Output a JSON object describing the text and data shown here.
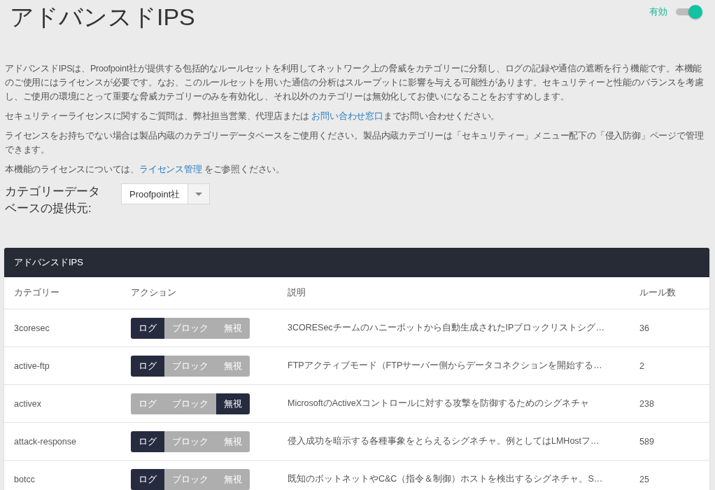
{
  "header": {
    "title": "アドバンスドIPS",
    "toggle": {
      "label": "有効",
      "on": true
    }
  },
  "paragraphs": [
    {
      "segments": [
        {
          "kind": "text",
          "text": "アドバンスドIPSは、Proofpoint社が提供する包括的なルールセットを利用してネットワーク上の脅威をカテゴリーに分類し、ログの記録や通信の遮断を行う機能です。本機能のご使用にはライセンスが必要です。なお、このルールセットを用いた通信の分析はスループットに影響を与える可能性があります。セキュリティーと性能のバランスを考慮し、ご使用の環境にとって重要な脅威カテゴリーのみを有効化し、それ以外のカテゴリーは無効化してお使いになることをおすすめします。"
        }
      ]
    },
    {
      "segments": [
        {
          "kind": "text",
          "text": "セキュリティーライセンスに関するご質問は、弊社担当営業、代理店または "
        },
        {
          "kind": "link",
          "text": "お問い合わせ窓口"
        },
        {
          "kind": "text",
          "text": "までお問い合わせください。"
        }
      ]
    },
    {
      "segments": [
        {
          "kind": "text",
          "text": "ライセンスをお持ちでない場合は製品内蔵のカテゴリーデータベースをご使用ください。製品内蔵カテゴリーは「セキュリティー」メニュー配下の「侵入防御」ページで管理できます。"
        }
      ]
    },
    {
      "segments": [
        {
          "kind": "text",
          "text": "本機能のライセンスについては、"
        },
        {
          "kind": "link",
          "text": "ライセンス管理"
        },
        {
          "kind": "text",
          "text": " をご参照ください。"
        }
      ]
    }
  ],
  "provider": {
    "label": "カテゴリーデータベースの提供元:",
    "value": "Proofpoint社"
  },
  "table": {
    "title": "アドバンスドIPS",
    "columns": [
      "カテゴリー",
      "アクション",
      "説明",
      "ルール数"
    ],
    "rows": [
      {
        "category": "3coresec",
        "actions": [
          {
            "label": "ログ",
            "selected": true
          },
          {
            "label": "ブロック",
            "selected": false
          },
          {
            "label": "無視",
            "selected": false
          }
        ],
        "description": "3CORESecチームのハニーポットから自動生成されたIPブロックリストシグ…",
        "count": "36"
      },
      {
        "category": "active-ftp",
        "actions": [
          {
            "label": "ログ",
            "selected": true
          },
          {
            "label": "ブロック",
            "selected": false
          },
          {
            "label": "無視",
            "selected": false
          }
        ],
        "description": "FTPアクティブモード（FTPサーバー側からデータコネクションを開始する…",
        "count": "2"
      },
      {
        "category": "activex",
        "actions": [
          {
            "label": "ログ",
            "selected": false
          },
          {
            "label": "ブロック",
            "selected": false
          },
          {
            "label": "無視",
            "selected": true
          }
        ],
        "description": "MicrosoftのActiveXコントロールに対する攻撃を防御するためのシグネチャ",
        "count": "238"
      },
      {
        "category": "attack-response",
        "actions": [
          {
            "label": "ログ",
            "selected": true
          },
          {
            "label": "ブロック",
            "selected": false
          },
          {
            "label": "無視",
            "selected": false
          }
        ],
        "description": "侵入成功を暗示する各種事象をとらえるシグネチャ。例としてはLMHostフ…",
        "count": "589"
      },
      {
        "category": "botcc",
        "actions": [
          {
            "label": "ログ",
            "selected": true
          },
          {
            "label": "ブロック",
            "selected": false
          },
          {
            "label": "無視",
            "selected": false
          }
        ],
        "description": "既知のボットネットやC&C（指令＆制御）ホストを検出するシグネチャ。S…",
        "count": "25"
      }
    ]
  }
}
